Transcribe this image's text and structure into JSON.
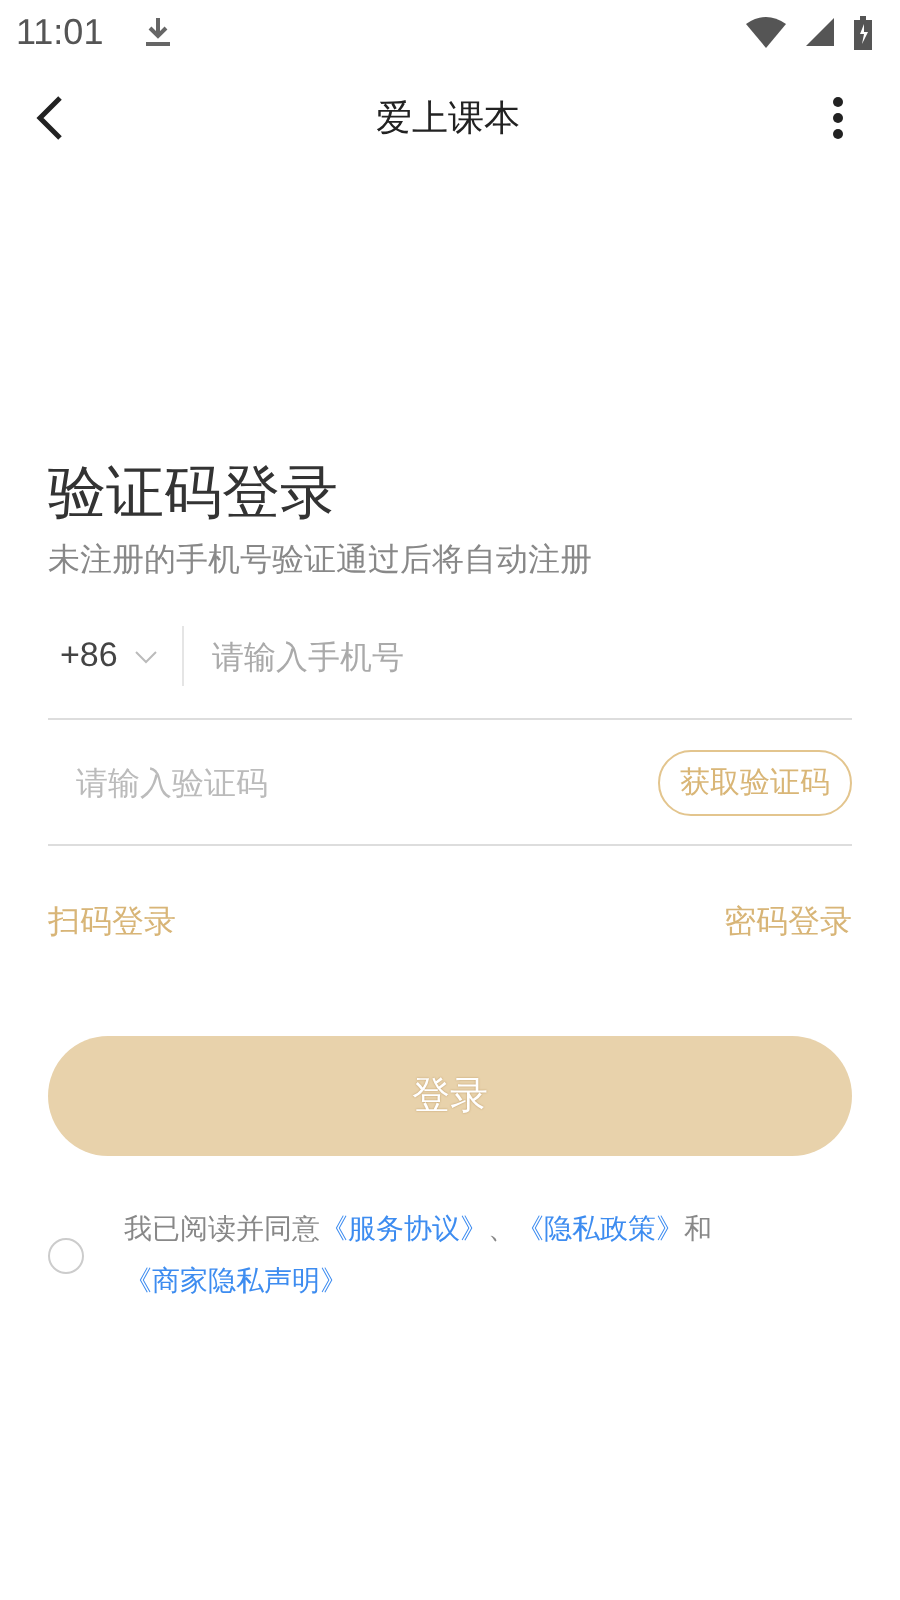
{
  "status_bar": {
    "time": "11:01"
  },
  "header": {
    "title": "爱上课本"
  },
  "login": {
    "title": "验证码登录",
    "subtitle": "未注册的手机号验证通过后将自动注册",
    "country_code": "+86",
    "phone": {
      "placeholder": "请输入手机号"
    },
    "code": {
      "placeholder": "请输入验证码"
    },
    "get_code_button": "获取验证码",
    "alt_links": [
      "扫码登录",
      "密码登录"
    ],
    "submit": {
      "label": "登录",
      "disabled": true
    },
    "agreement": {
      "checked": false,
      "parts": [
        {
          "kind": "text",
          "text": "我已阅读并同意"
        },
        {
          "kind": "link",
          "text": "《服务协议》"
        },
        {
          "kind": "text",
          "text": "、"
        },
        {
          "kind": "link",
          "text": "《隐私政策》"
        },
        {
          "kind": "text",
          "text": "和"
        },
        {
          "kind": "link",
          "text": "《商家隐私声明》"
        }
      ]
    }
  }
}
